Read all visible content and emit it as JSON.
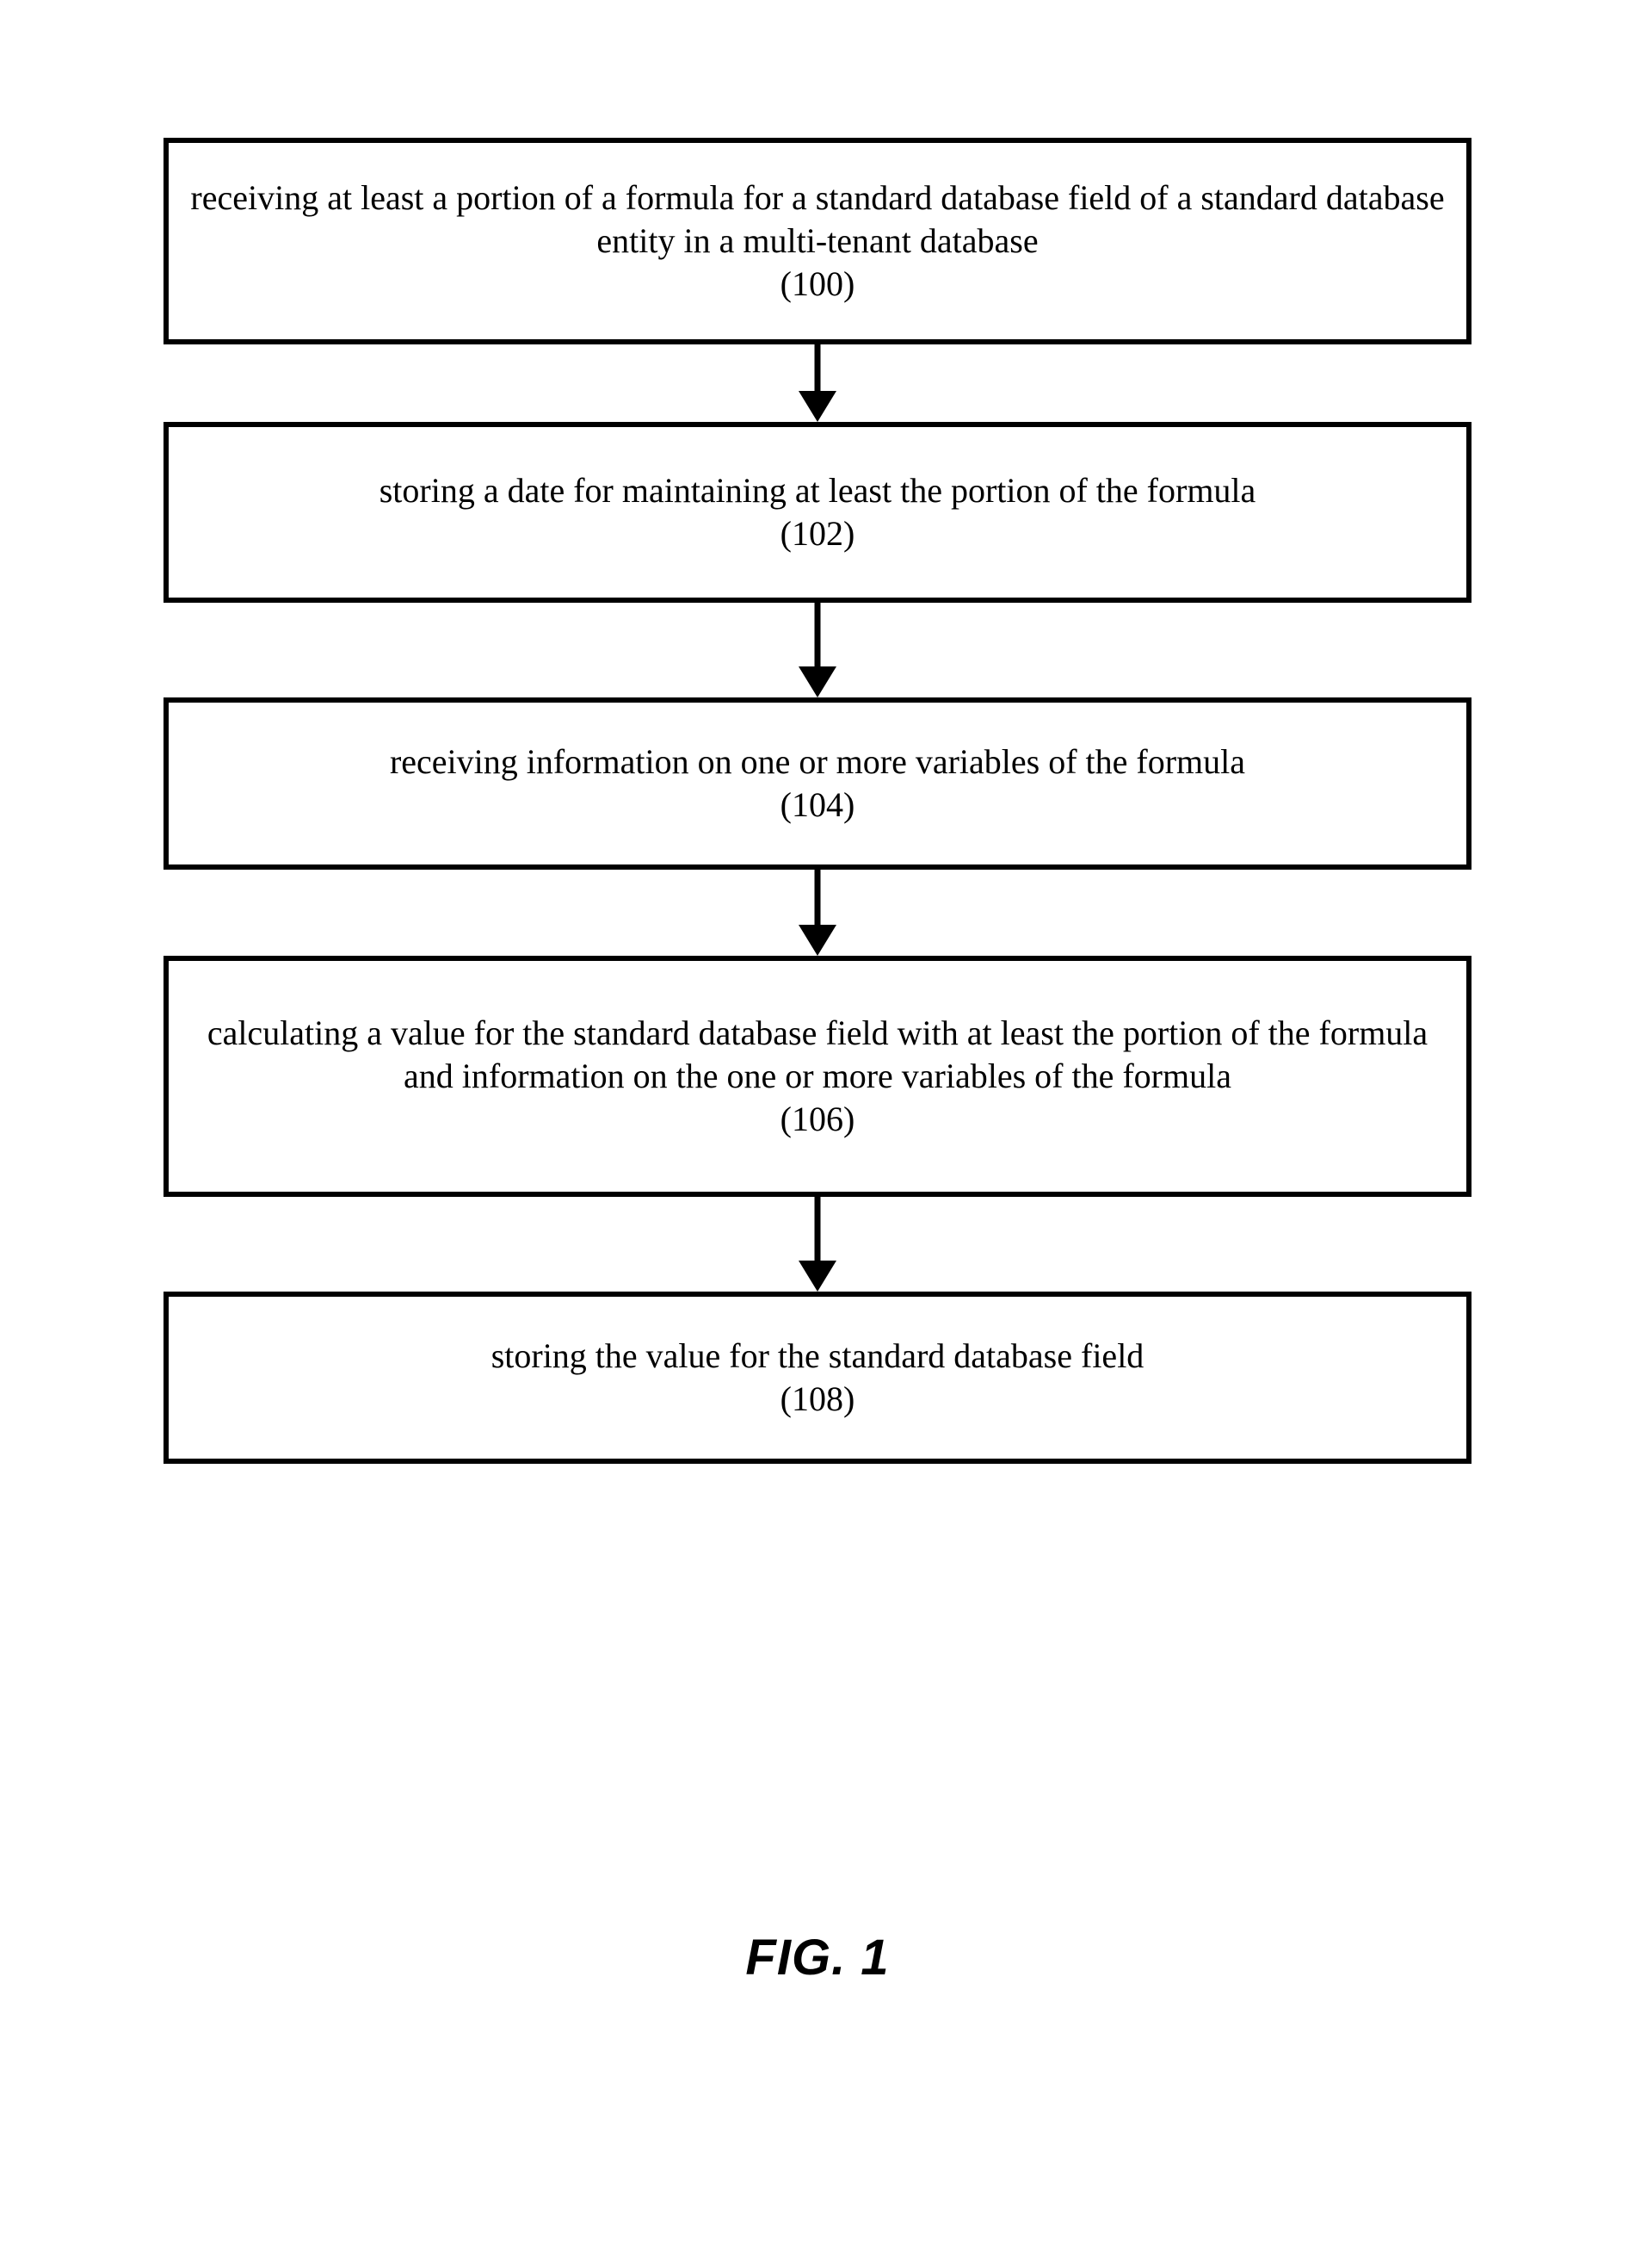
{
  "chart_data": {
    "type": "flowchart",
    "title": "FIG. 1",
    "steps": [
      {
        "id": "100",
        "text": "receiving at least a portion of a formula for a standard database field of a standard database entity in a multi-tenant database"
      },
      {
        "id": "102",
        "text": "storing a date for maintaining at least the portion of the formula"
      },
      {
        "id": "104",
        "text": "receiving information on one or more variables of the formula"
      },
      {
        "id": "106",
        "text": "calculating a value for the standard database field with at least the portion of the formula and information on the one or more variables of the formula"
      },
      {
        "id": "108",
        "text": "storing the value for the standard database field"
      }
    ],
    "edges": [
      {
        "from": "100",
        "to": "102"
      },
      {
        "from": "102",
        "to": "104"
      },
      {
        "from": "104",
        "to": "106"
      },
      {
        "from": "106",
        "to": "108"
      }
    ]
  },
  "figure_label": "FIG. 1",
  "steps": {
    "s0": {
      "text": "receiving at least a portion of a formula for a standard database field of a standard database entity in a multi-tenant database",
      "ref": "(100)"
    },
    "s1": {
      "text": "storing a date for maintaining at least the portion of the formula",
      "ref": "(102)"
    },
    "s2": {
      "text": "receiving information on one or more variables of the formula",
      "ref": "(104)"
    },
    "s3": {
      "text": "calculating a value for the standard database field with at least the portion of the formula and information on the one or more variables of the formula",
      "ref": "(106)"
    },
    "s4": {
      "text": "storing the value for the standard database field",
      "ref": "(108)"
    }
  }
}
